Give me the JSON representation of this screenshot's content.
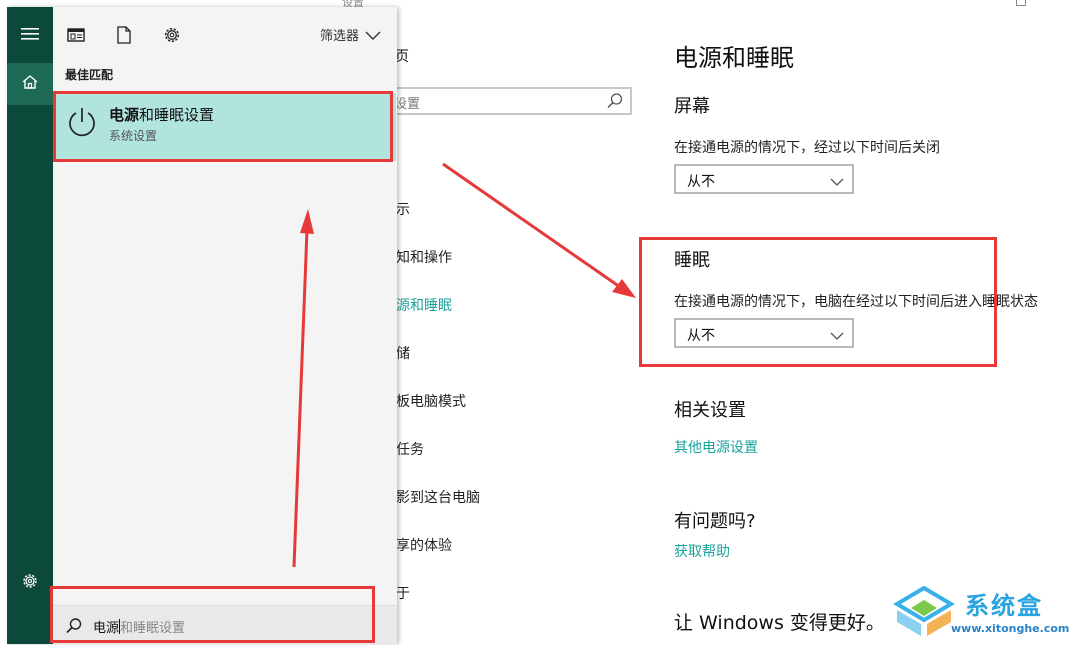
{
  "settings_window": {
    "title_fragment": "设置",
    "nav": {
      "home_fragment": "页",
      "search_placeholder": "设置",
      "items": [
        {
          "label": "示"
        },
        {
          "label": "知和操作"
        },
        {
          "label": "源和睡眠",
          "active": true
        },
        {
          "label": "储"
        },
        {
          "label": "板电脑模式"
        },
        {
          "label": "任务"
        },
        {
          "label": "影到这台电脑"
        },
        {
          "label": "享的体验"
        },
        {
          "label": "于"
        }
      ]
    },
    "content": {
      "title": "电源和睡眠",
      "screen": {
        "heading": "屏幕",
        "description": "在接通电源的情况下，经过以下时间后关闭",
        "select_value": "从不"
      },
      "sleep": {
        "heading": "睡眠",
        "description": "在接通电源的情况下，电脑在经过以下时间后进入睡眠状态",
        "select_value": "从不"
      },
      "related": {
        "heading": "相关设置",
        "link": "其他电源设置"
      },
      "help": {
        "heading": "有问题吗?",
        "link": "获取帮助"
      },
      "feedback_heading": "让 Windows 变得更好。"
    }
  },
  "start_menu": {
    "filter_label": "筛选器",
    "best_match_label": "最佳匹配",
    "result": {
      "title_bold": "电源",
      "title_rest": "和睡眠设置",
      "subtitle": "系统设置"
    },
    "search": {
      "typed": "电源",
      "suggestion": "和睡眠设置"
    },
    "rail_icons": [
      "hamburger-icon",
      "home-icon",
      "gear-icon"
    ],
    "toolbar_icons": [
      "apps-icon",
      "document-icon",
      "settings-icon"
    ]
  },
  "watermark": {
    "name": "系统盒",
    "url": "www.xitonghe.com"
  },
  "colors": {
    "accent": "#1aa39b",
    "rail": "#0b4a3a",
    "rail_active": "#1f6a56",
    "result_highlight": "#b2e4de",
    "annotation": "#e63a3a"
  }
}
